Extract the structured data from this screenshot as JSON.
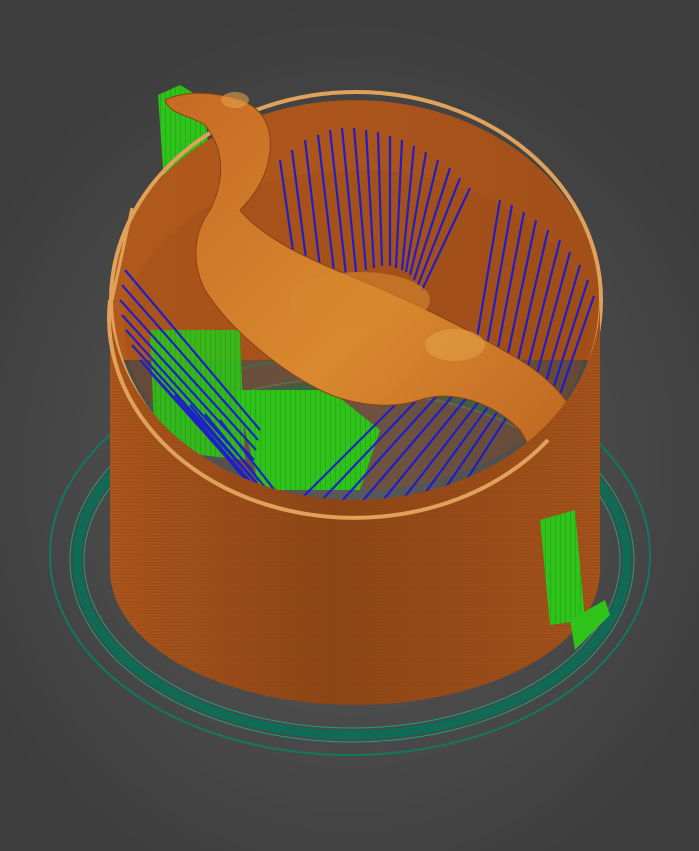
{
  "viewport": {
    "kind": "gcode-preview-3d",
    "background_color": "#4a4a4a"
  },
  "extrusion_roles": [
    {
      "role": "perimeter",
      "color": "#c0621f"
    },
    {
      "role": "support",
      "color": "#2fc21a"
    },
    {
      "role": "travel",
      "color": "#1c1ccc"
    },
    {
      "role": "skirt",
      "color": "#0f7a5f"
    }
  ],
  "model": {
    "object": "seal-figure",
    "enclosure": "cylindrical-shield"
  }
}
